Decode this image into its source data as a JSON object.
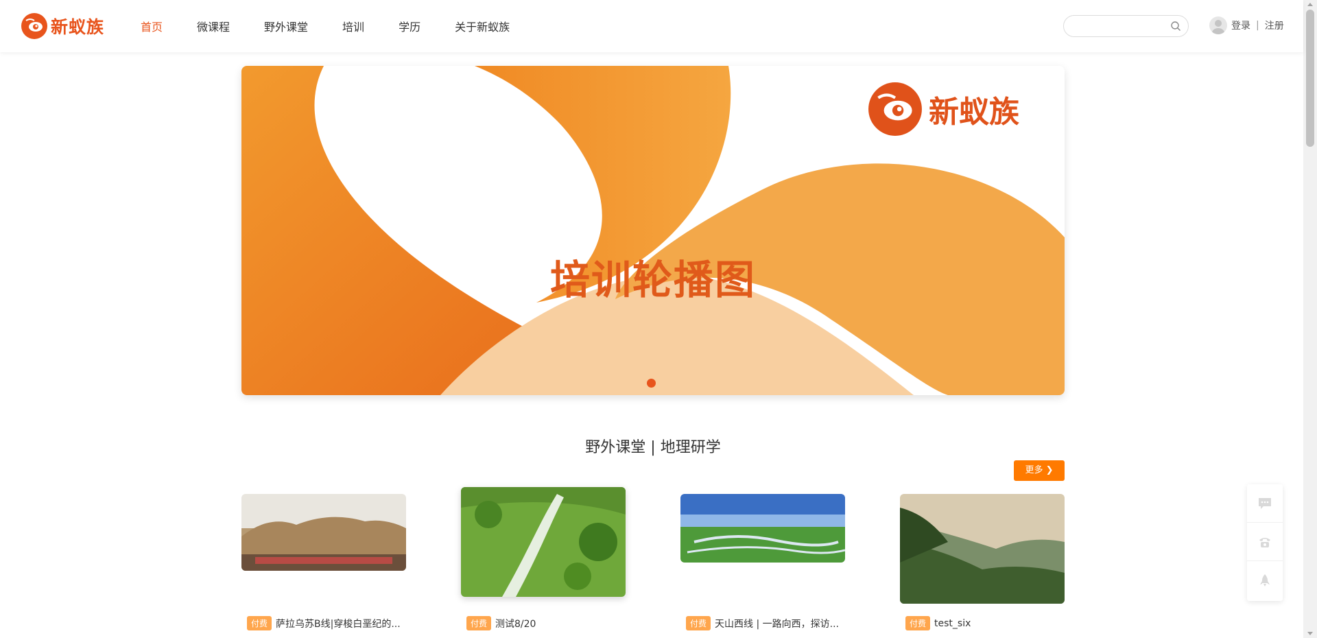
{
  "header": {
    "logo_text": "新蚁族",
    "nav": [
      "首页",
      "微课程",
      "野外课堂",
      "培训",
      "学历",
      "关于新蚁族"
    ],
    "search_placeholder": "",
    "login": "登录",
    "separator": "|",
    "register": "注册"
  },
  "banner": {
    "title": "培训轮播图",
    "logo_text": "新蚁族"
  },
  "section": {
    "title": "野外课堂 | 地理研学",
    "more_label": "更多 ❯"
  },
  "cards": [
    {
      "tag": "付费",
      "title": "萨拉乌苏B线|穿梭白垩纪的..."
    },
    {
      "tag": "付费",
      "title": "测试8/20"
    },
    {
      "tag": "付费",
      "title": "天山西线 | 一路向西，探访..."
    },
    {
      "tag": "付费",
      "title": "test_six"
    }
  ],
  "colors": {
    "brand": "#e8541c",
    "accent": "#ff7a00",
    "tag": "#ffa64d"
  }
}
